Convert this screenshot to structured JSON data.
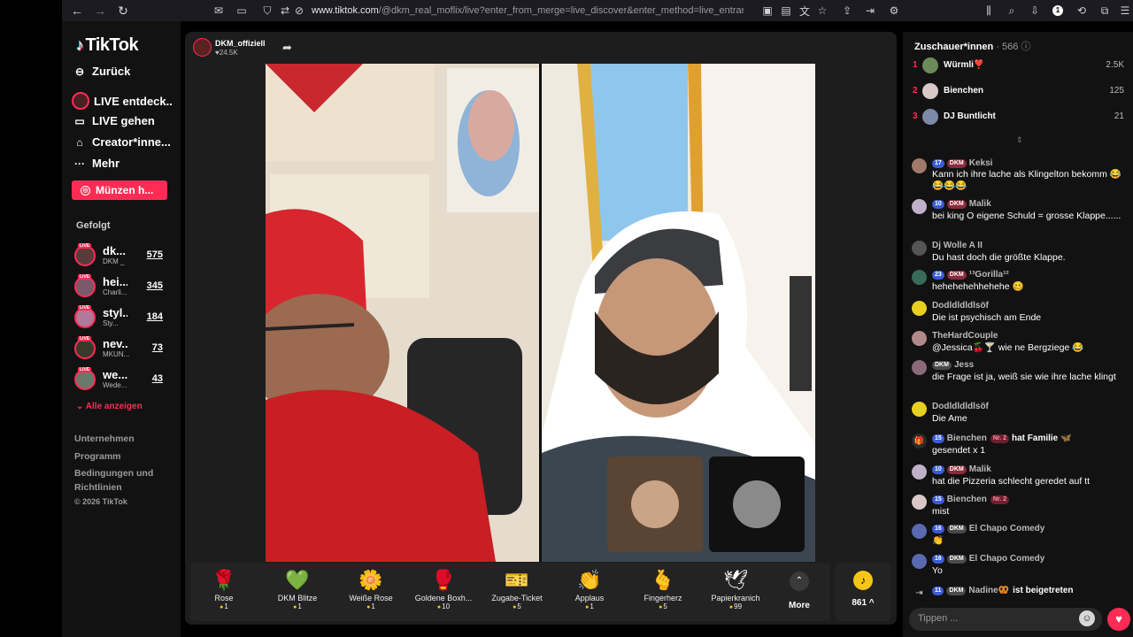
{
  "browser": {
    "url_host": "www.tiktok.com",
    "url_rest": "/@dkm_real_moflix/live?enter_from_merge=live_discover&enter_method=live_entrance_hover_la"
  },
  "sidebar": {
    "logo": "TikTok",
    "back": "Zurück",
    "links": [
      "LIVE entdeck..",
      "LIVE gehen",
      "Creator*inne...",
      "Mehr"
    ],
    "coins_button": "Münzen h...",
    "followed_heading": "Gefolgt",
    "followed": [
      {
        "name": "dk...",
        "sub": "DKM _",
        "count": "575"
      },
      {
        "name": "hei...",
        "sub": "Charli...",
        "count": "345"
      },
      {
        "name": "styl...",
        "sub": "Sty...",
        "count": "184"
      },
      {
        "name": "nev...",
        "sub": "MKUN...",
        "count": "73"
      },
      {
        "name": "we...",
        "sub": "Wede...",
        "count": "43"
      }
    ],
    "show_all": "Alle anzeigen",
    "footer": [
      "Unternehmen",
      "Programm",
      "Bedingungen und",
      "Richtlinien",
      "© 2026 TikTok"
    ]
  },
  "stream": {
    "host_name": "DKM_offiziell",
    "host_likes": "24.5K"
  },
  "gifts": [
    {
      "name": "Rose",
      "price": "1",
      "icon": "🌹"
    },
    {
      "name": "DKM Blitze",
      "price": "1",
      "icon": "💚"
    },
    {
      "name": "Weiße Rose",
      "price": "1",
      "icon": "🌼"
    },
    {
      "name": "Goldene Boxh...",
      "price": "10",
      "icon": "🥊"
    },
    {
      "name": "Zugabe-Ticket",
      "price": "5",
      "icon": "🎫"
    },
    {
      "name": "Applaus",
      "price": "1",
      "icon": "👏"
    },
    {
      "name": "Fingerherz",
      "price": "5",
      "icon": "🫰"
    },
    {
      "name": "Papierkranich",
      "price": "99",
      "icon": "🕊"
    }
  ],
  "more_label": "More",
  "coin_balance": "861 ^",
  "panel": {
    "viewers_label": "Zuschauer*innen",
    "viewers_count": "· 566",
    "top_viewers": [
      {
        "rank": "1",
        "name": "Würmli❣️",
        "value": "2.5K"
      },
      {
        "rank": "2",
        "name": "Bienchen",
        "value": "125"
      },
      {
        "rank": "3",
        "name": "DJ Buntlicht",
        "value": "21"
      }
    ],
    "messages": [
      {
        "level": "17",
        "fan": "DKM",
        "user": "Keksi",
        "text": "Kann ich ihre lache als Klingelton bekomm 😂😂😂😂"
      },
      {
        "level": "10",
        "fan": "DKM",
        "user": "Malik",
        "text": "bei king O eigene Schuld = grosse Klappe......"
      },
      {
        "level": "",
        "fan": "",
        "user": "Dj Wolle A II",
        "text": "Du hast doch die größte Klappe."
      },
      {
        "level": "23",
        "fan": "DKM",
        "user": "¹³Gorilla¹²",
        "text": "hehehehehhehehe 🥴"
      },
      {
        "level": "",
        "fan": "",
        "user": "Dodldldldlsöf",
        "text": "Die ist psychisch am Ende"
      },
      {
        "level": "",
        "fan": "",
        "user": "TheHardCouple",
        "text": "@Jessica🍒🍸 wie ne Bergziege 😂"
      },
      {
        "level": "",
        "fan": "DKM",
        "user": "Jess",
        "text": "die Frage ist ja, weiß sie wie ihre lache klingt"
      },
      {
        "level": "",
        "fan": "",
        "user": "Dodldldldlsöf",
        "text": "Die Ame"
      },
      {
        "level": "15",
        "fan": "Nr. 2",
        "user": "Bienchen",
        "text": "gesendet x 1",
        "extra": "hat Familie 🦋"
      },
      {
        "level": "10",
        "fan": "DKM",
        "user": "Malik",
        "text": "hat die Pizzeria schlecht geredet auf tt"
      },
      {
        "level": "15",
        "fan": "Nr. 2",
        "user": "Bienchen",
        "text": "mist"
      },
      {
        "level": "16",
        "fan": "DKM",
        "user": "El Chapo Comedy",
        "text": "👏"
      },
      {
        "level": "16",
        "fan": "DKM",
        "user": "El Chapo Comedy",
        "text": "Yo"
      },
      {
        "level": "11",
        "fan": "DKM",
        "user": "Nadine🥨",
        "text": "",
        "extra": "ist beigetreten"
      }
    ],
    "input_placeholder": "Tippen ..."
  }
}
